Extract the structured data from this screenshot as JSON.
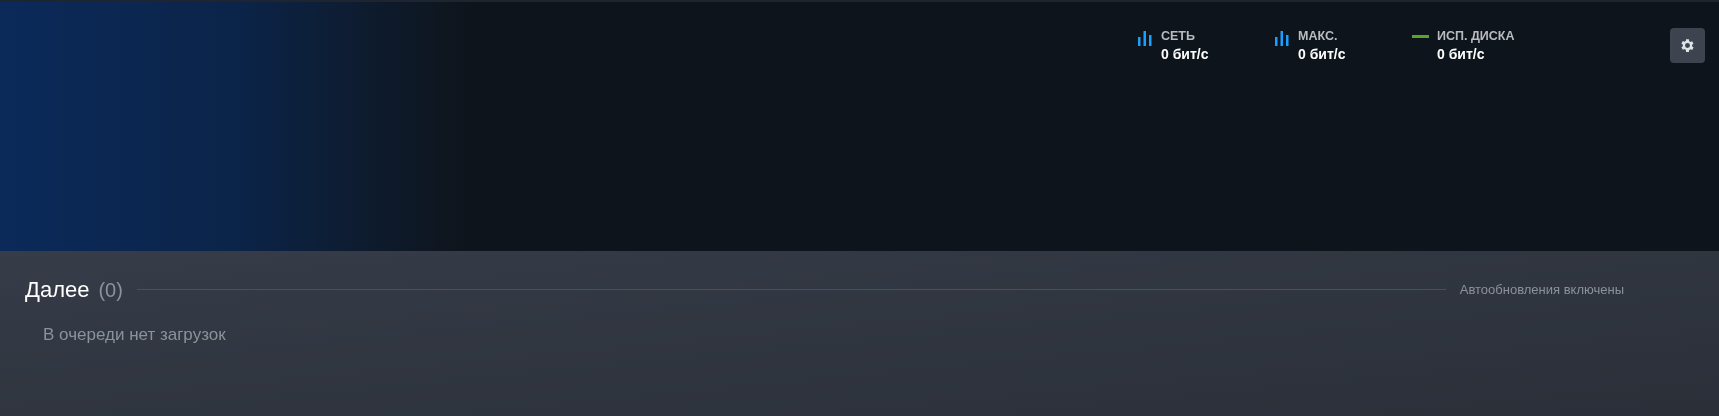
{
  "stats": [
    {
      "kind": "bars",
      "color": "#1a9fff",
      "label": "СЕТЬ",
      "value": "0 бит/с"
    },
    {
      "kind": "bars",
      "color": "#1a9fff",
      "label": "МАКС.",
      "value": "0 бит/с"
    },
    {
      "kind": "line",
      "color": "#5ba32b",
      "label": "ИСП. ДИСКА",
      "value": "0 бит/с"
    }
  ],
  "queue": {
    "title": "Далее",
    "count": "(0)",
    "status": "Автообновления включены",
    "empty_message": "В очереди нет загрузок"
  }
}
